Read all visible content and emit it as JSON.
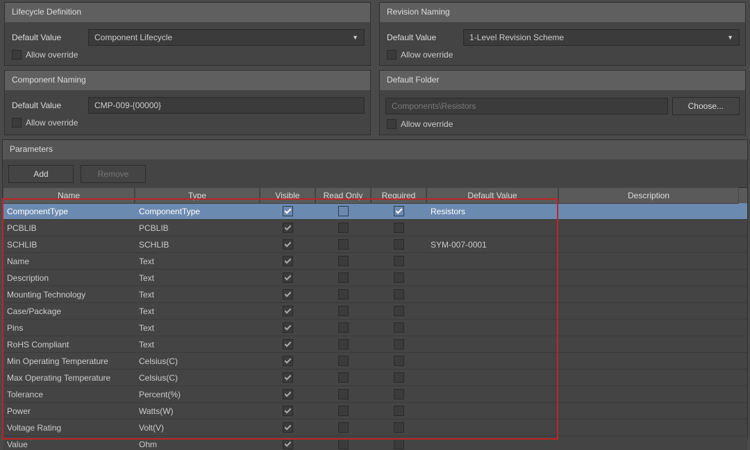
{
  "lifecycle": {
    "title": "Lifecycle Definition",
    "label": "Default Value",
    "value": "Component Lifecycle",
    "override": "Allow override"
  },
  "revision": {
    "title": "Revision Naming",
    "label": "Default Value",
    "value": "1-Level Revision Scheme",
    "override": "Allow override"
  },
  "compNaming": {
    "title": "Component Naming",
    "label": "Default Value",
    "value": "CMP-009-{00000}",
    "override": "Allow override"
  },
  "folder": {
    "title": "Default Folder",
    "value": "Components\\Resistors",
    "button": "Choose...",
    "override": "Allow override"
  },
  "params": {
    "title": "Parameters",
    "addBtn": "Add",
    "removeBtn": "Remove",
    "cols": [
      "Name",
      "Type",
      "Visible",
      "Read Only",
      "Required",
      "Default Value",
      "Description"
    ],
    "rows": [
      {
        "name": "ComponentType",
        "type": "ComponentType",
        "visible": true,
        "readOnly": false,
        "required": true,
        "default": "Resistors",
        "desc": "",
        "selected": true
      },
      {
        "name": "PCBLIB",
        "type": "PCBLIB",
        "visible": true,
        "readOnly": false,
        "required": false,
        "default": "",
        "desc": ""
      },
      {
        "name": "SCHLIB",
        "type": "SCHLIB",
        "visible": true,
        "readOnly": false,
        "required": false,
        "default": "SYM-007-0001",
        "desc": ""
      },
      {
        "name": "Name",
        "type": "Text",
        "visible": true,
        "readOnly": false,
        "required": false,
        "default": "",
        "desc": ""
      },
      {
        "name": "Description",
        "type": "Text",
        "visible": true,
        "readOnly": false,
        "required": false,
        "default": "",
        "desc": ""
      },
      {
        "name": "Mounting Technology",
        "type": "Text",
        "visible": true,
        "readOnly": false,
        "required": false,
        "default": "",
        "desc": ""
      },
      {
        "name": "Case/Package",
        "type": "Text",
        "visible": true,
        "readOnly": false,
        "required": false,
        "default": "",
        "desc": ""
      },
      {
        "name": "Pins",
        "type": "Text",
        "visible": true,
        "readOnly": false,
        "required": false,
        "default": "",
        "desc": ""
      },
      {
        "name": "RoHS Compliant",
        "type": "Text",
        "visible": true,
        "readOnly": false,
        "required": false,
        "default": "",
        "desc": ""
      },
      {
        "name": "Min Operating Temperature",
        "type": "Celsius(C)",
        "visible": true,
        "readOnly": false,
        "required": false,
        "default": "",
        "desc": ""
      },
      {
        "name": "Max Operating Temperature",
        "type": "Celsius(C)",
        "visible": true,
        "readOnly": false,
        "required": false,
        "default": "",
        "desc": ""
      },
      {
        "name": "Tolerance",
        "type": "Percent(%)",
        "visible": true,
        "readOnly": false,
        "required": false,
        "default": "",
        "desc": ""
      },
      {
        "name": "Power",
        "type": "Watts(W)",
        "visible": true,
        "readOnly": false,
        "required": false,
        "default": "",
        "desc": ""
      },
      {
        "name": "Voltage Rating",
        "type": "Volt(V)",
        "visible": true,
        "readOnly": false,
        "required": false,
        "default": "",
        "desc": ""
      },
      {
        "name": "Value",
        "type": "Ohm",
        "visible": true,
        "readOnly": false,
        "required": false,
        "default": "",
        "desc": ""
      }
    ]
  }
}
